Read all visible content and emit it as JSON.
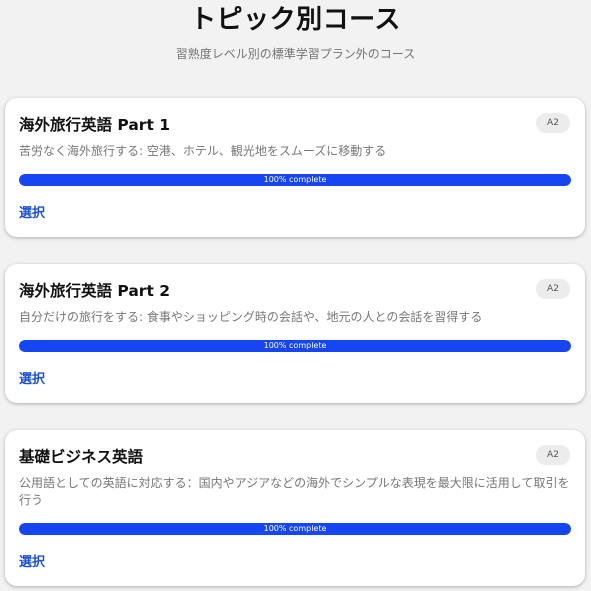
{
  "header": {
    "title": "トピック別コース",
    "subtitle": "習熟度レベル別の標準学習プラン外のコース"
  },
  "colors": {
    "accent": "#1646f2",
    "link": "#1b4fd6"
  },
  "courses": [
    {
      "title": "海外旅行英語 Part 1",
      "level": "A2",
      "description": "苦労なく海外旅行する: 空港、ホテル、観光地をスムーズに移動する",
      "progress_percent": 100,
      "progress_label": "100% complete",
      "action_label": "選択"
    },
    {
      "title": "海外旅行英語 Part 2",
      "level": "A2",
      "description": "自分だけの旅行をする: 食事やショッピング時の会話や、地元の人との会話を習得する",
      "progress_percent": 100,
      "progress_label": "100% complete",
      "action_label": "選択"
    },
    {
      "title": "基礎ビジネス英語",
      "level": "A2",
      "description": "公用語としての英語に対応する：国内やアジアなどの海外でシンプルな表現を最大限に活用して取引を行う",
      "progress_percent": 100,
      "progress_label": "100% complete",
      "action_label": "選択"
    }
  ]
}
